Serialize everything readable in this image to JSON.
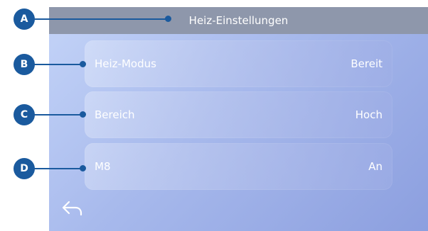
{
  "header": {
    "title": "Heiz-Einstellungen"
  },
  "rows": [
    {
      "label": "Heiz-Modus",
      "value": "Bereit"
    },
    {
      "label": "Bereich",
      "value": "Hoch"
    },
    {
      "label": "M8",
      "value": "An"
    }
  ],
  "callouts": [
    "A",
    "B",
    "C",
    "D"
  ],
  "icons": {
    "back": "back-arrow-icon"
  },
  "colors": {
    "callout": "#1a5a9e",
    "title_bar": "#8e97ab"
  }
}
